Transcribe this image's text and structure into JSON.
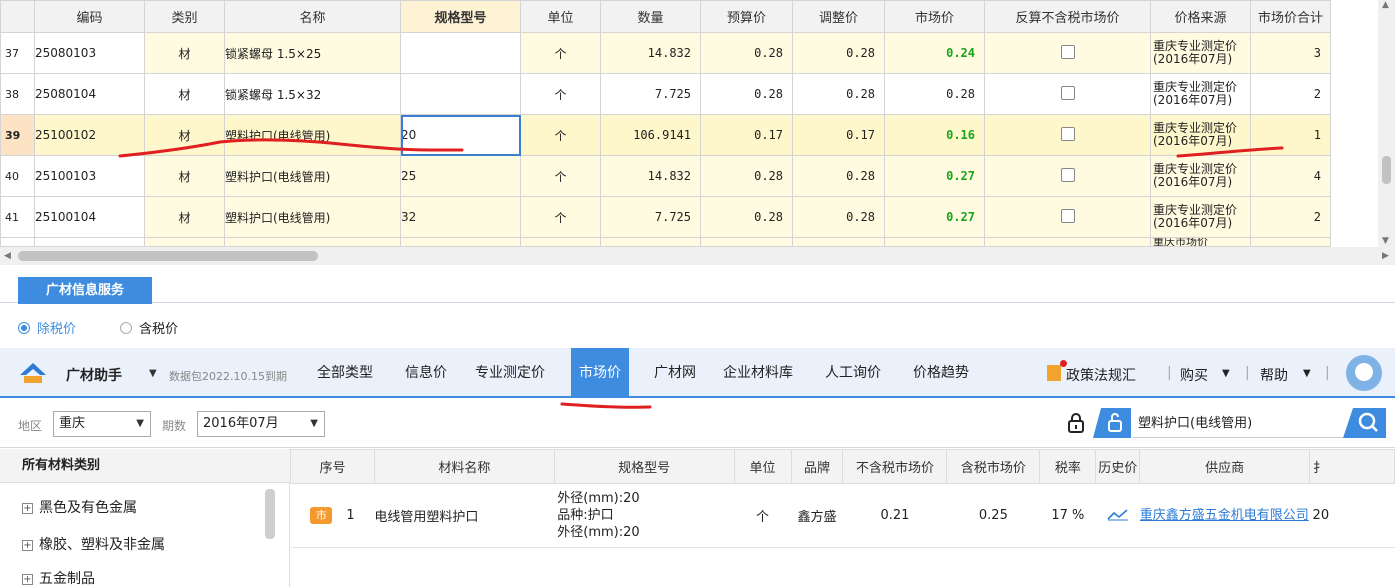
{
  "grid": {
    "headers": {
      "code": "编码",
      "type": "类别",
      "name": "名称",
      "spec": "规格型号",
      "unit": "单位",
      "qty": "数量",
      "budget": "预算价",
      "adjust": "调整价",
      "market": "市场价",
      "reverse": "反算不含税市场价",
      "source": "价格来源",
      "total": "市场价合计"
    },
    "rows": [
      {
        "no": "37",
        "code": "25080103",
        "type": "材",
        "name": "锁紧螺母  1.5×25",
        "spec": "",
        "unit": "个",
        "qty": "14.832",
        "budget": "0.28",
        "adjust": "0.28",
        "market": "0.24",
        "src1": "重庆专业测定价",
        "src2": "(2016年07月)",
        "total": "3"
      },
      {
        "no": "38",
        "code": "25080104",
        "type": "材",
        "name": "锁紧螺母  1.5×32",
        "spec": "",
        "unit": "个",
        "qty": "7.725",
        "budget": "0.28",
        "adjust": "0.28",
        "market": "0.28",
        "src1": "重庆专业测定价",
        "src2": "(2016年07月)",
        "total": "2"
      },
      {
        "no": "39",
        "code": "25100102",
        "type": "材",
        "name": "塑料护口(电线管用)",
        "spec": "20",
        "unit": "个",
        "qty": "106.9141",
        "budget": "0.17",
        "adjust": "0.17",
        "market": "0.16",
        "src1": "重庆专业测定价",
        "src2": "(2016年07月)",
        "total": "1"
      },
      {
        "no": "40",
        "code": "25100103",
        "type": "材",
        "name": "塑料护口(电线管用)",
        "spec": "25",
        "unit": "个",
        "qty": "14.832",
        "budget": "0.28",
        "adjust": "0.28",
        "market": "0.27",
        "src1": "重庆专业测定价",
        "src2": "(2016年07月)",
        "total": "4"
      },
      {
        "no": "41",
        "code": "25100104",
        "type": "材",
        "name": "塑料护口(电线管用)",
        "spec": "32",
        "unit": "个",
        "qty": "7.725",
        "budget": "0.28",
        "adjust": "0.28",
        "market": "0.27",
        "src1": "重庆专业测定价",
        "src2": "(2016年07月)",
        "total": "2"
      }
    ],
    "partial_src": "重庆市场价"
  },
  "service_tab": "广材信息服务",
  "price_mode": {
    "options": [
      "除税价",
      "含税价"
    ],
    "selected": "除税价"
  },
  "nav": {
    "brand": "广材助手",
    "package": "数据包2022.10.15到期",
    "tabs": [
      "全部类型",
      "信息价",
      "专业测定价",
      "市场价",
      "广材网",
      "企业材料库",
      "人工询价",
      "价格趋势"
    ],
    "active_tab": "市场价",
    "policy": "政策法规汇",
    "buy": "购买",
    "help": "帮助"
  },
  "filter": {
    "region_label": "地区",
    "region": "重庆",
    "period_label": "期数",
    "period": "2016年07月",
    "search_value": "塑料护口(电线管用)"
  },
  "categories": {
    "header": "所有材料类别",
    "items": [
      "黑色及有色金属",
      "橡胶、塑料及非金属",
      "五金制品"
    ]
  },
  "results": {
    "headers": [
      "序号",
      "材料名称",
      "规格型号",
      "单位",
      "品牌",
      "不含税市场价",
      "含税市场价",
      "税率",
      "历史价",
      "供应商",
      "扌"
    ],
    "rows": [
      {
        "tag": "市",
        "no": "1",
        "name": "电线管用塑料护口",
        "spec1": "外径(mm):20",
        "spec2": "品种:护口",
        "spec3": "外径(mm):20",
        "unit": "个",
        "brand": "鑫方盛",
        "price_ex": "0.21",
        "price_inc": "0.25",
        "tax": "17 %",
        "supplier": "重庆鑫方盛五金机电有限公司",
        "extra": "20"
      }
    ]
  },
  "colors": {
    "accent": "#3d8ce0",
    "green_price": "#1aa51a",
    "row_yellow": "#fffbe1",
    "annotation": "#e02020"
  }
}
